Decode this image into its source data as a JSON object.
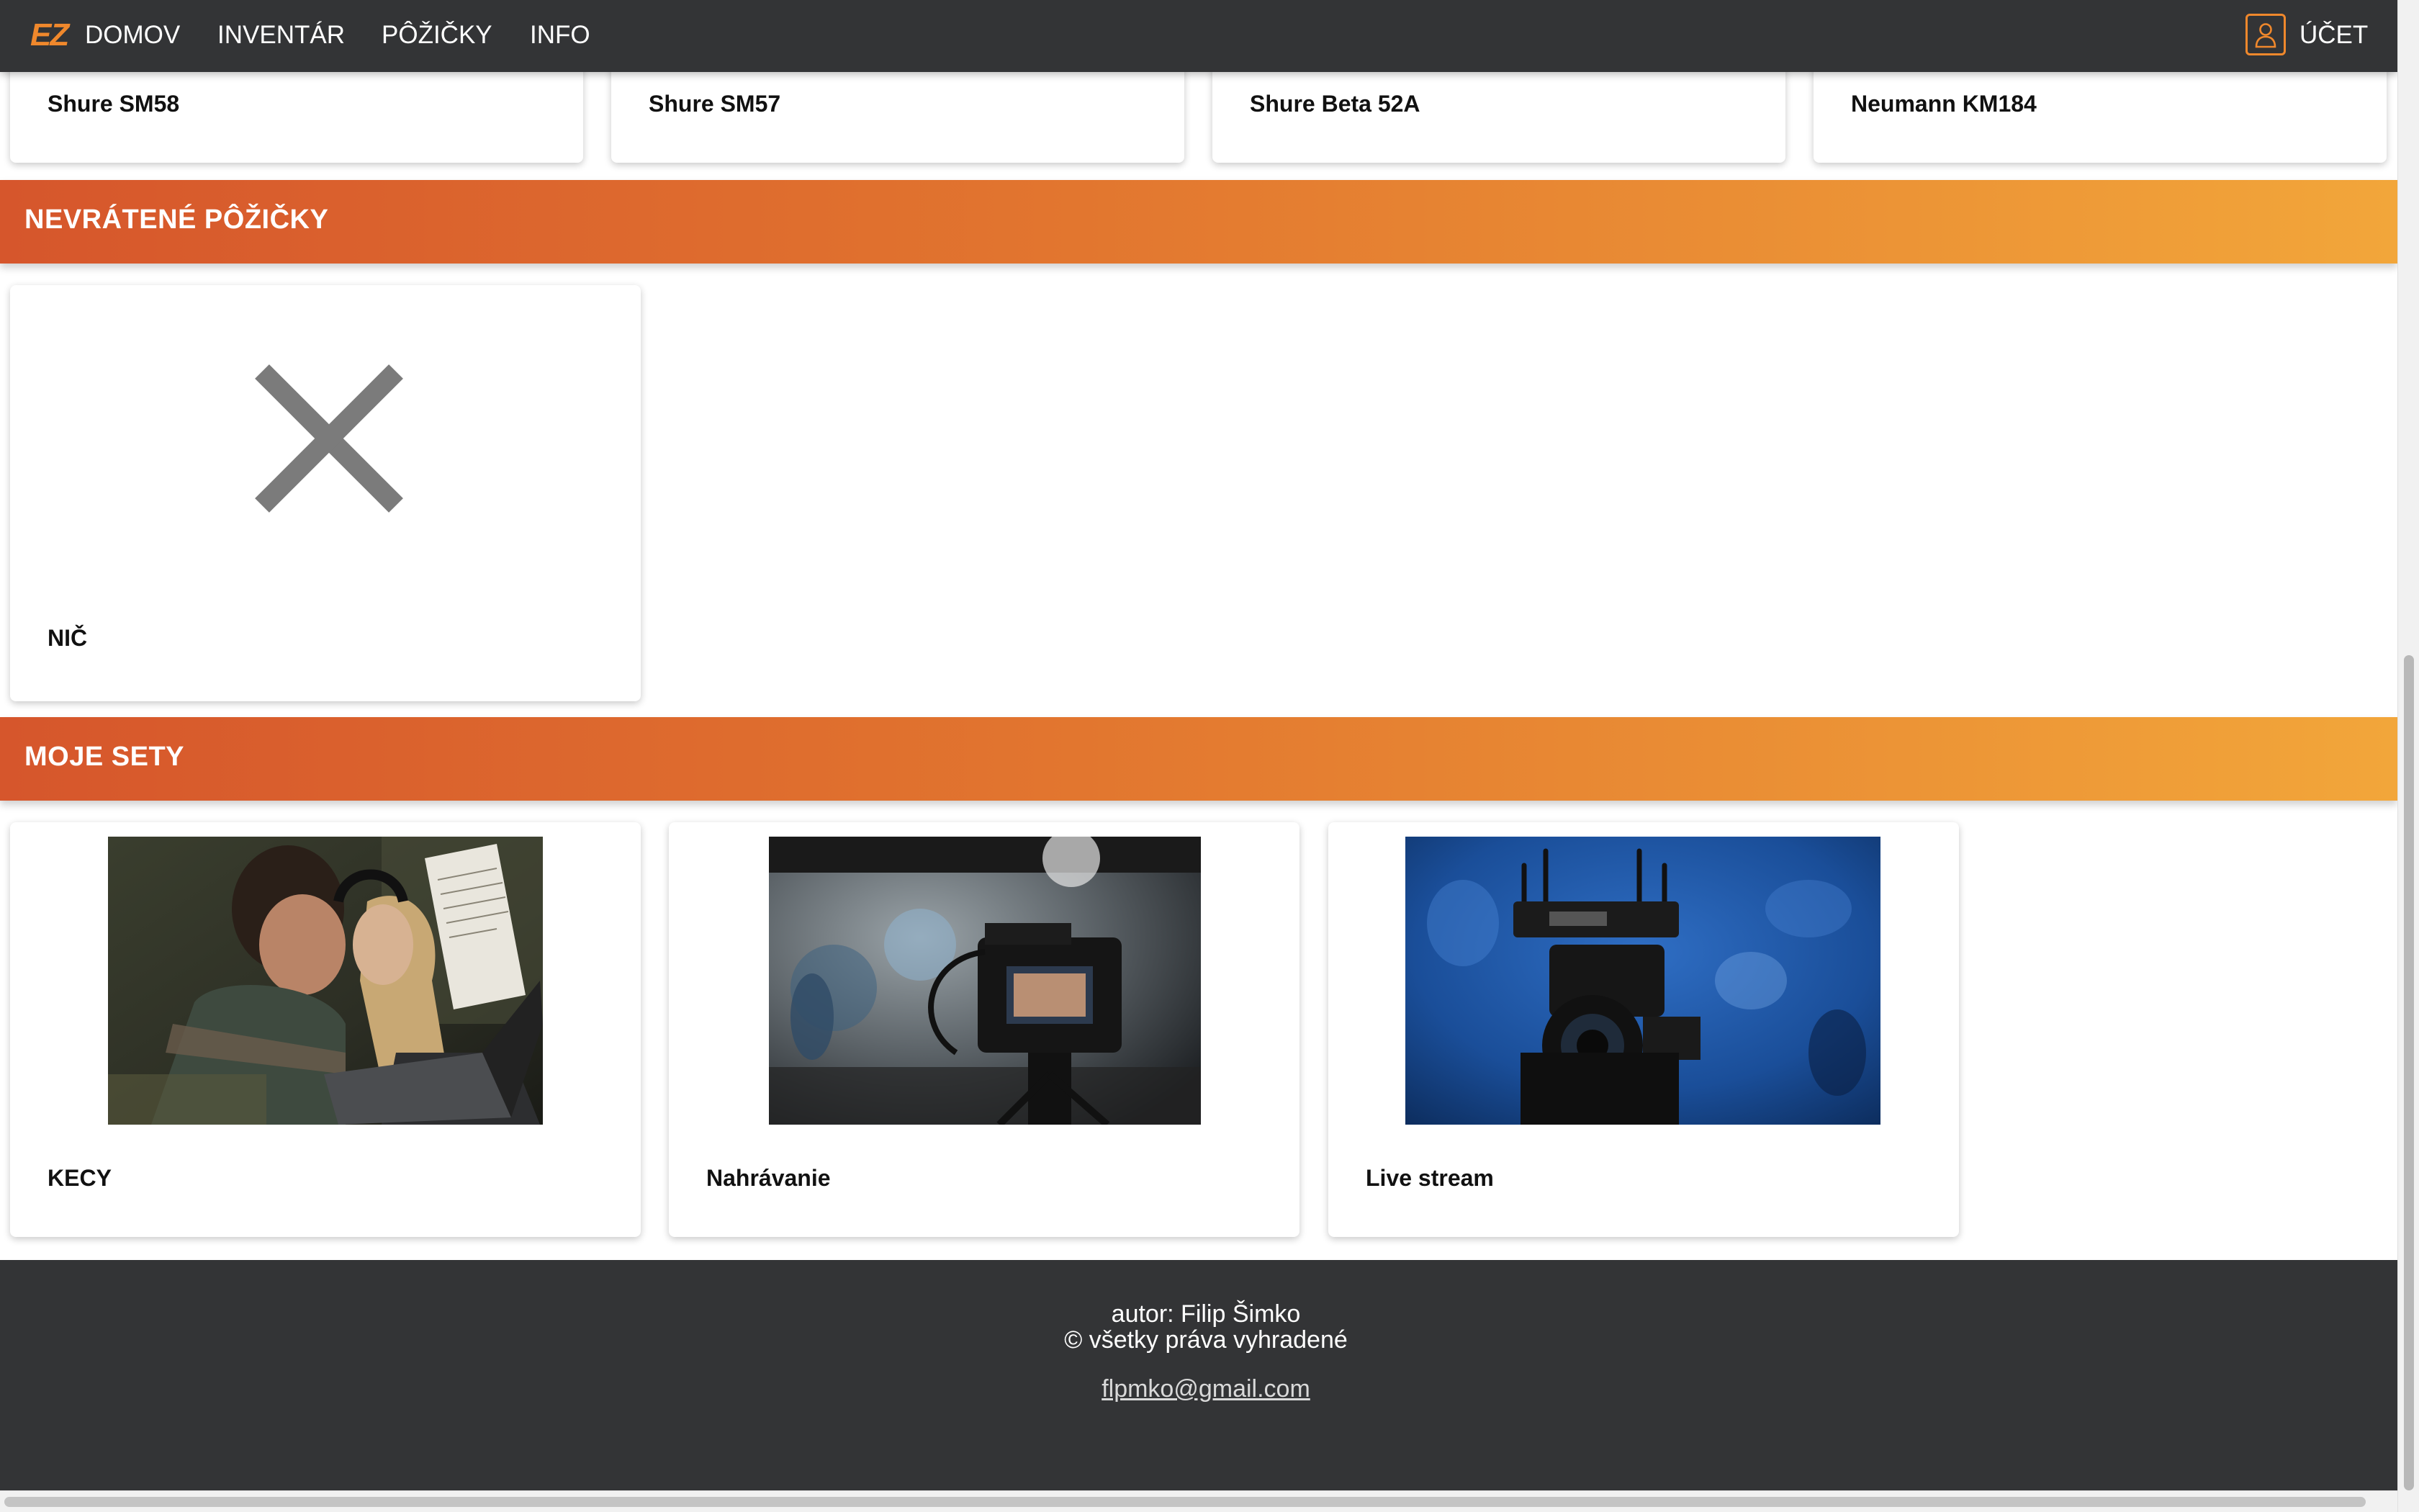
{
  "nav": {
    "logo": "EZ",
    "home": "DOMOV",
    "inventory": "INVENTÁR",
    "loans": "PÔŽIČKY",
    "info": "INFO",
    "account": "ÚČET"
  },
  "inventory_cards": [
    {
      "title": "Shure SM58"
    },
    {
      "title": "Shure SM57"
    },
    {
      "title": "Shure Beta 52A"
    },
    {
      "title": "Neumann KM184"
    }
  ],
  "unreturned": {
    "title": "NEVRÁTENÉ PÔŽIČKY",
    "empty_icon": "close-icon",
    "empty_label": "NIČ"
  },
  "sets": {
    "title": "MOJE SETY",
    "items": [
      {
        "title": "KECY",
        "image": "people-reviewing-script-photo"
      },
      {
        "title": "Nahrávanie",
        "image": "camera-recording-studio-photo"
      },
      {
        "title": "Live stream",
        "image": "camera-with-wireless-transmitter-photo"
      }
    ]
  },
  "footer": {
    "author": "autor: Filip Šimko",
    "rights": "© všetky práva vyhradené",
    "email": "flpmko@gmail.com"
  },
  "colors": {
    "navbar": "#333436",
    "accent": "#f0882c",
    "header_gradient_start": "#d6562c",
    "header_gradient_end": "#f2a63a"
  }
}
